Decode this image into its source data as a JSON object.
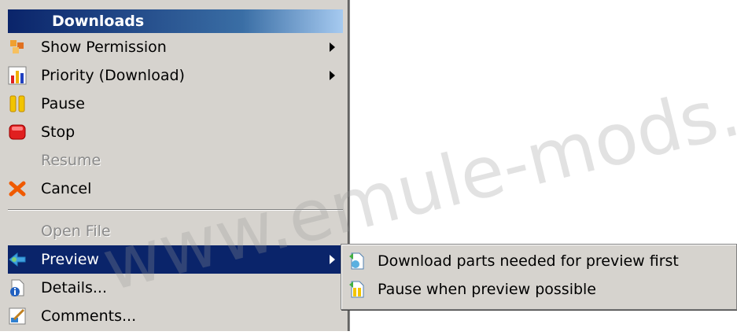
{
  "menu": {
    "title": "Downloads",
    "items": [
      {
        "label": "Show Permission",
        "icon": "permission-icon",
        "has_submenu": true,
        "disabled": false
      },
      {
        "label": "Priority (Download)",
        "icon": "priority-chart-icon",
        "has_submenu": true,
        "disabled": false
      },
      {
        "label": "Pause",
        "icon": "pause-icon",
        "has_submenu": false,
        "disabled": false
      },
      {
        "label": "Stop",
        "icon": "stop-icon",
        "has_submenu": false,
        "disabled": false
      },
      {
        "label": "Resume",
        "icon": "",
        "has_submenu": false,
        "disabled": true
      },
      {
        "label": "Cancel",
        "icon": "cancel-x-icon",
        "has_submenu": false,
        "disabled": false
      },
      {
        "label": "Open File",
        "icon": "",
        "has_submenu": false,
        "disabled": true
      },
      {
        "label": "Preview",
        "icon": "preview-arrow-icon",
        "has_submenu": true,
        "disabled": false,
        "highlighted": true
      },
      {
        "label": "Details...",
        "icon": "details-info-icon",
        "has_submenu": false,
        "disabled": false
      },
      {
        "label": "Comments...",
        "icon": "comments-icon",
        "has_submenu": false,
        "disabled": false
      }
    ]
  },
  "submenu": {
    "items": [
      {
        "label": "Download parts needed for preview first",
        "icon": "download-parts-icon"
      },
      {
        "label": "Pause when preview possible",
        "icon": "pause-preview-icon"
      }
    ]
  },
  "watermark": {
    "text": "www.emule-mods.it"
  },
  "colors": {
    "menu_bg": "#d6d3ce",
    "highlight": "#0a246a",
    "header_start": "#0a246a",
    "header_end": "#a6caf0"
  }
}
